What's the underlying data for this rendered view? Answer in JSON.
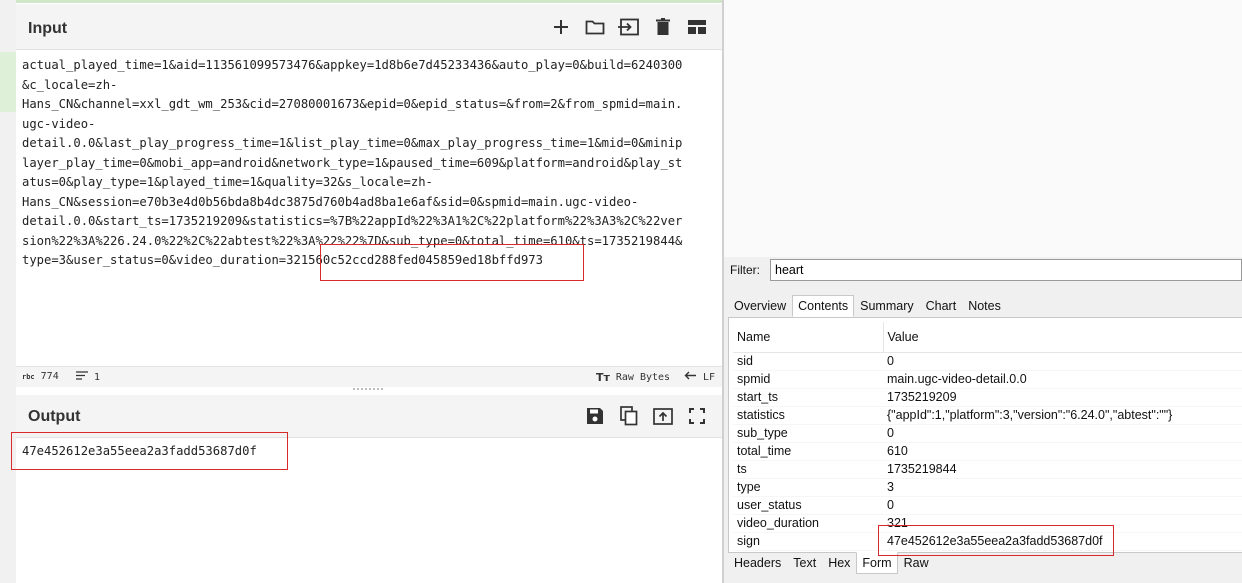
{
  "input": {
    "title": "Input",
    "lines": [
      "actual_played_time=1&aid=113561099573476&appkey=1d8b6e7d45233436&auto_play=0&build=6240300",
      "&c_locale=zh-",
      "Hans_CN&channel=xxl_gdt_wm_253&cid=27080001673&epid=0&epid_status=&from=2&from_spmid=main.",
      "ugc-video-",
      "detail.0.0&last_play_progress_time=1&list_play_time=0&max_play_progress_time=1&mid=0&minip",
      "layer_play_time=0&mobi_app=android&network_type=1&paused_time=609&platform=android&play_st",
      "atus=0&play_type=1&played_time=1&quality=32&s_locale=zh-",
      "Hans_CN&session=e70b3e4d0b56bda8b4dc3875d760b4ad8ba1e6af&sid=0&spmid=main.ugc-video-",
      "detail.0.0&start_ts=1735219209&statistics=%7B%22appId%22%3A1%2C%22platform%22%3A3%2C%22ver",
      "sion%22%3A%226.24.0%22%2C%22abtest%22%3A%22%22%7D&sub_type=0&total_time=610&ts=1735219844&",
      "type=3&user_status=0&video_duration=321560c52ccd288fed045859ed18bffd973"
    ],
    "icons": [
      "plus-icon",
      "folder-icon",
      "import-icon",
      "trash-icon",
      "layout-icon"
    ]
  },
  "status": {
    "length_icon": "rbc",
    "length": "774",
    "lines": "1",
    "raw_bytes_icon": "Tт",
    "raw_bytes": "Raw Bytes",
    "eol": "LF"
  },
  "output": {
    "title": "Output",
    "value": "47e452612e3a55eea2a3fadd53687d0f",
    "icons": [
      "save-icon",
      "copy-icon",
      "replace-input-icon",
      "fullscreen-icon"
    ]
  },
  "filter": {
    "label": "Filter:",
    "value": "heart"
  },
  "inspector_tabs": [
    {
      "label": "Overview",
      "active": false
    },
    {
      "label": "Contents",
      "active": true
    },
    {
      "label": "Summary",
      "active": false
    },
    {
      "label": "Chart",
      "active": false
    },
    {
      "label": "Notes",
      "active": false
    }
  ],
  "form_table": {
    "headers": {
      "name": "Name",
      "value": "Value"
    },
    "rows": [
      {
        "name": "sid",
        "value": "0"
      },
      {
        "name": "spmid",
        "value": "main.ugc-video-detail.0.0"
      },
      {
        "name": "start_ts",
        "value": "1735219209"
      },
      {
        "name": "statistics",
        "value": "{\"appId\":1,\"platform\":3,\"version\":\"6.24.0\",\"abtest\":\"\"}"
      },
      {
        "name": "sub_type",
        "value": "0"
      },
      {
        "name": "total_time",
        "value": "610"
      },
      {
        "name": "ts",
        "value": "1735219844"
      },
      {
        "name": "type",
        "value": "3"
      },
      {
        "name": "user_status",
        "value": "0"
      },
      {
        "name": "video_duration",
        "value": "321"
      },
      {
        "name": "sign",
        "value": "47e452612e3a55eea2a3fadd53687d0f"
      }
    ]
  },
  "bottom_tabs": [
    {
      "label": "Headers",
      "active": false
    },
    {
      "label": "Text",
      "active": false
    },
    {
      "label": "Hex",
      "active": false
    },
    {
      "label": "Form",
      "active": true
    },
    {
      "label": "Raw",
      "active": false
    }
  ],
  "colors": {
    "highlight_box": "#d92a2a",
    "panel_header": "#f4f4f4",
    "gutter_green": "#dff0d8"
  }
}
